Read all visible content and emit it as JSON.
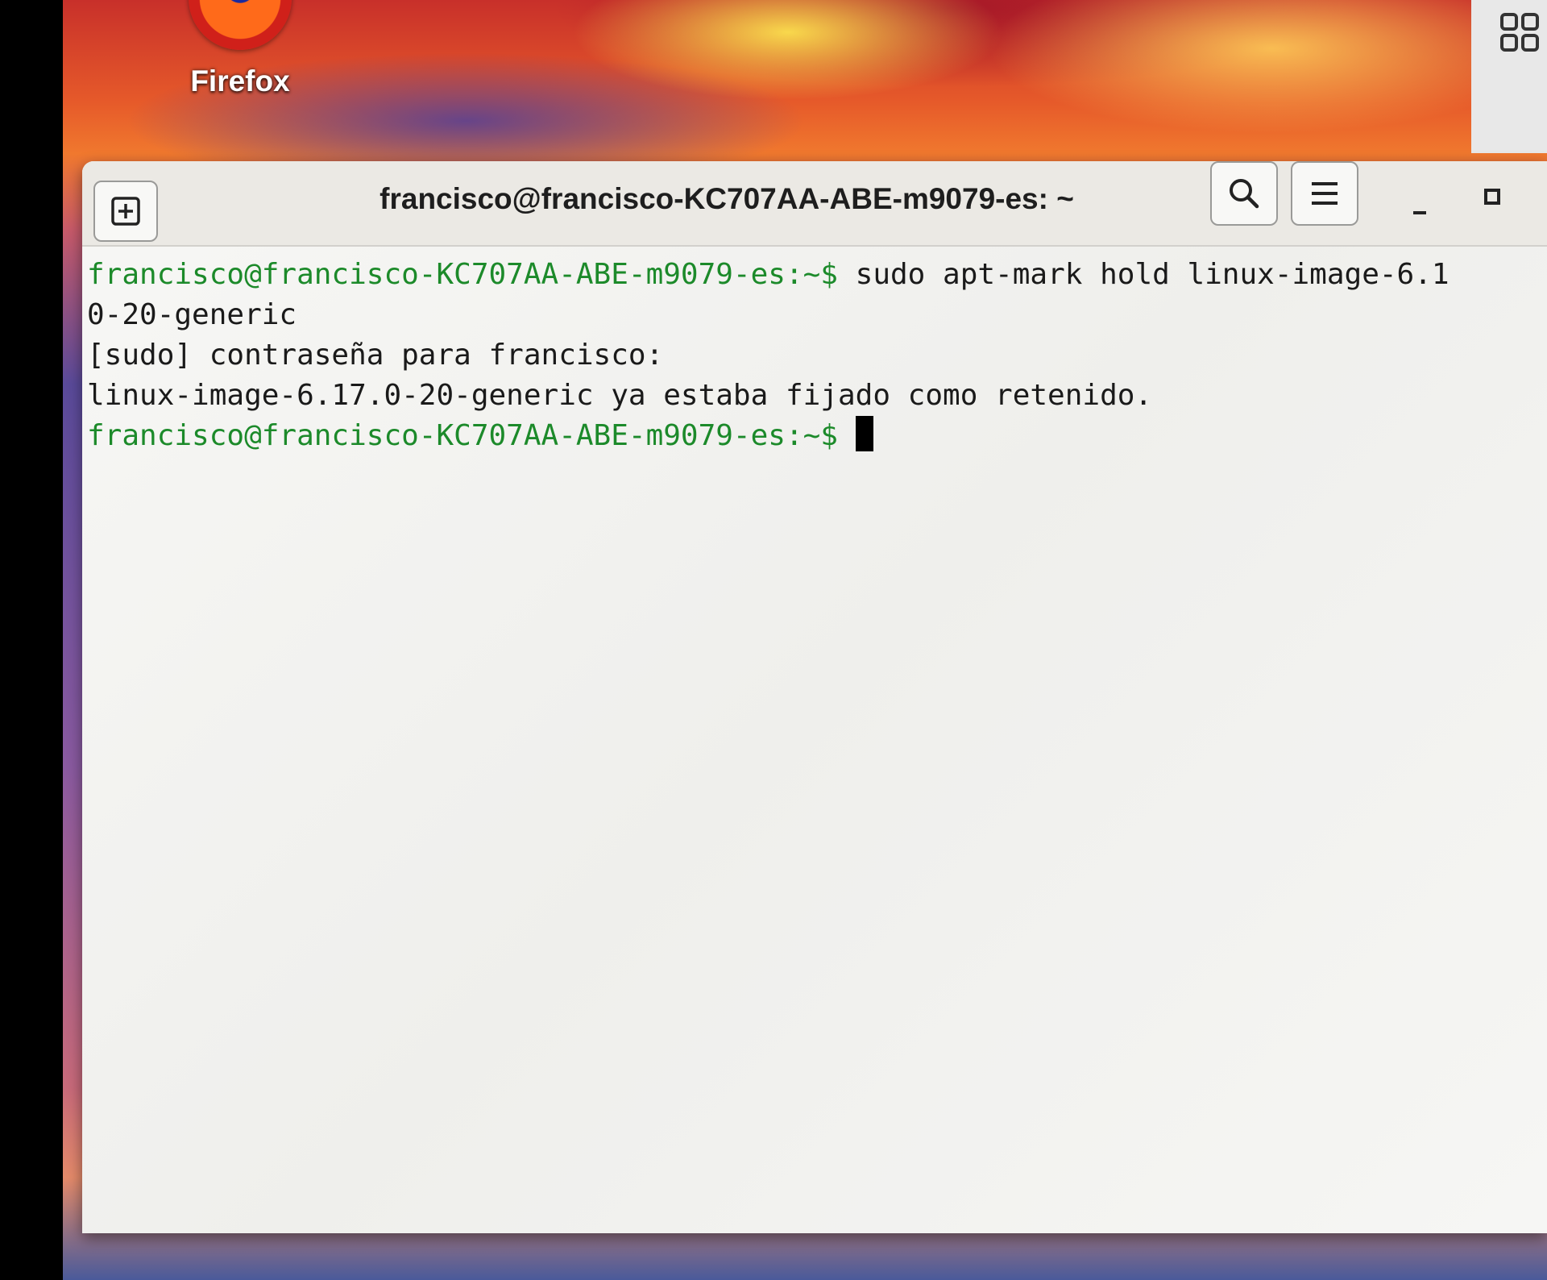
{
  "desktop": {
    "launchers": [
      {
        "label": "Firefox",
        "icon": "firefox-icon"
      }
    ],
    "panel": {
      "icon": "apps-grid-icon"
    }
  },
  "terminal": {
    "title": "francisco@francisco-KC707AA-ABE-m9079-es: ~",
    "buttons": {
      "new_tab": "new-tab-icon",
      "search": "search-icon",
      "menu": "hamburger-menu-icon",
      "minimize": "minimize-icon",
      "maximize": "maximize-icon"
    },
    "colors": {
      "prompt": "#1c8a2a",
      "text": "#1a1a1a",
      "background": "#f5f5f3"
    },
    "lines": [
      {
        "prompt": "francisco@francisco-KC707AA-ABE-m9079-es:~$",
        "text": " sudo apt-mark hold linux-image-6.1"
      },
      {
        "prompt": "",
        "text": "0-20-generic"
      },
      {
        "prompt": "",
        "text": "[sudo] contraseña para francisco:"
      },
      {
        "prompt": "",
        "text": "linux-image-6.17.0-20-generic ya estaba fijado como retenido."
      },
      {
        "prompt": "francisco@francisco-KC707AA-ABE-m9079-es:~$",
        "text": " "
      }
    ]
  }
}
